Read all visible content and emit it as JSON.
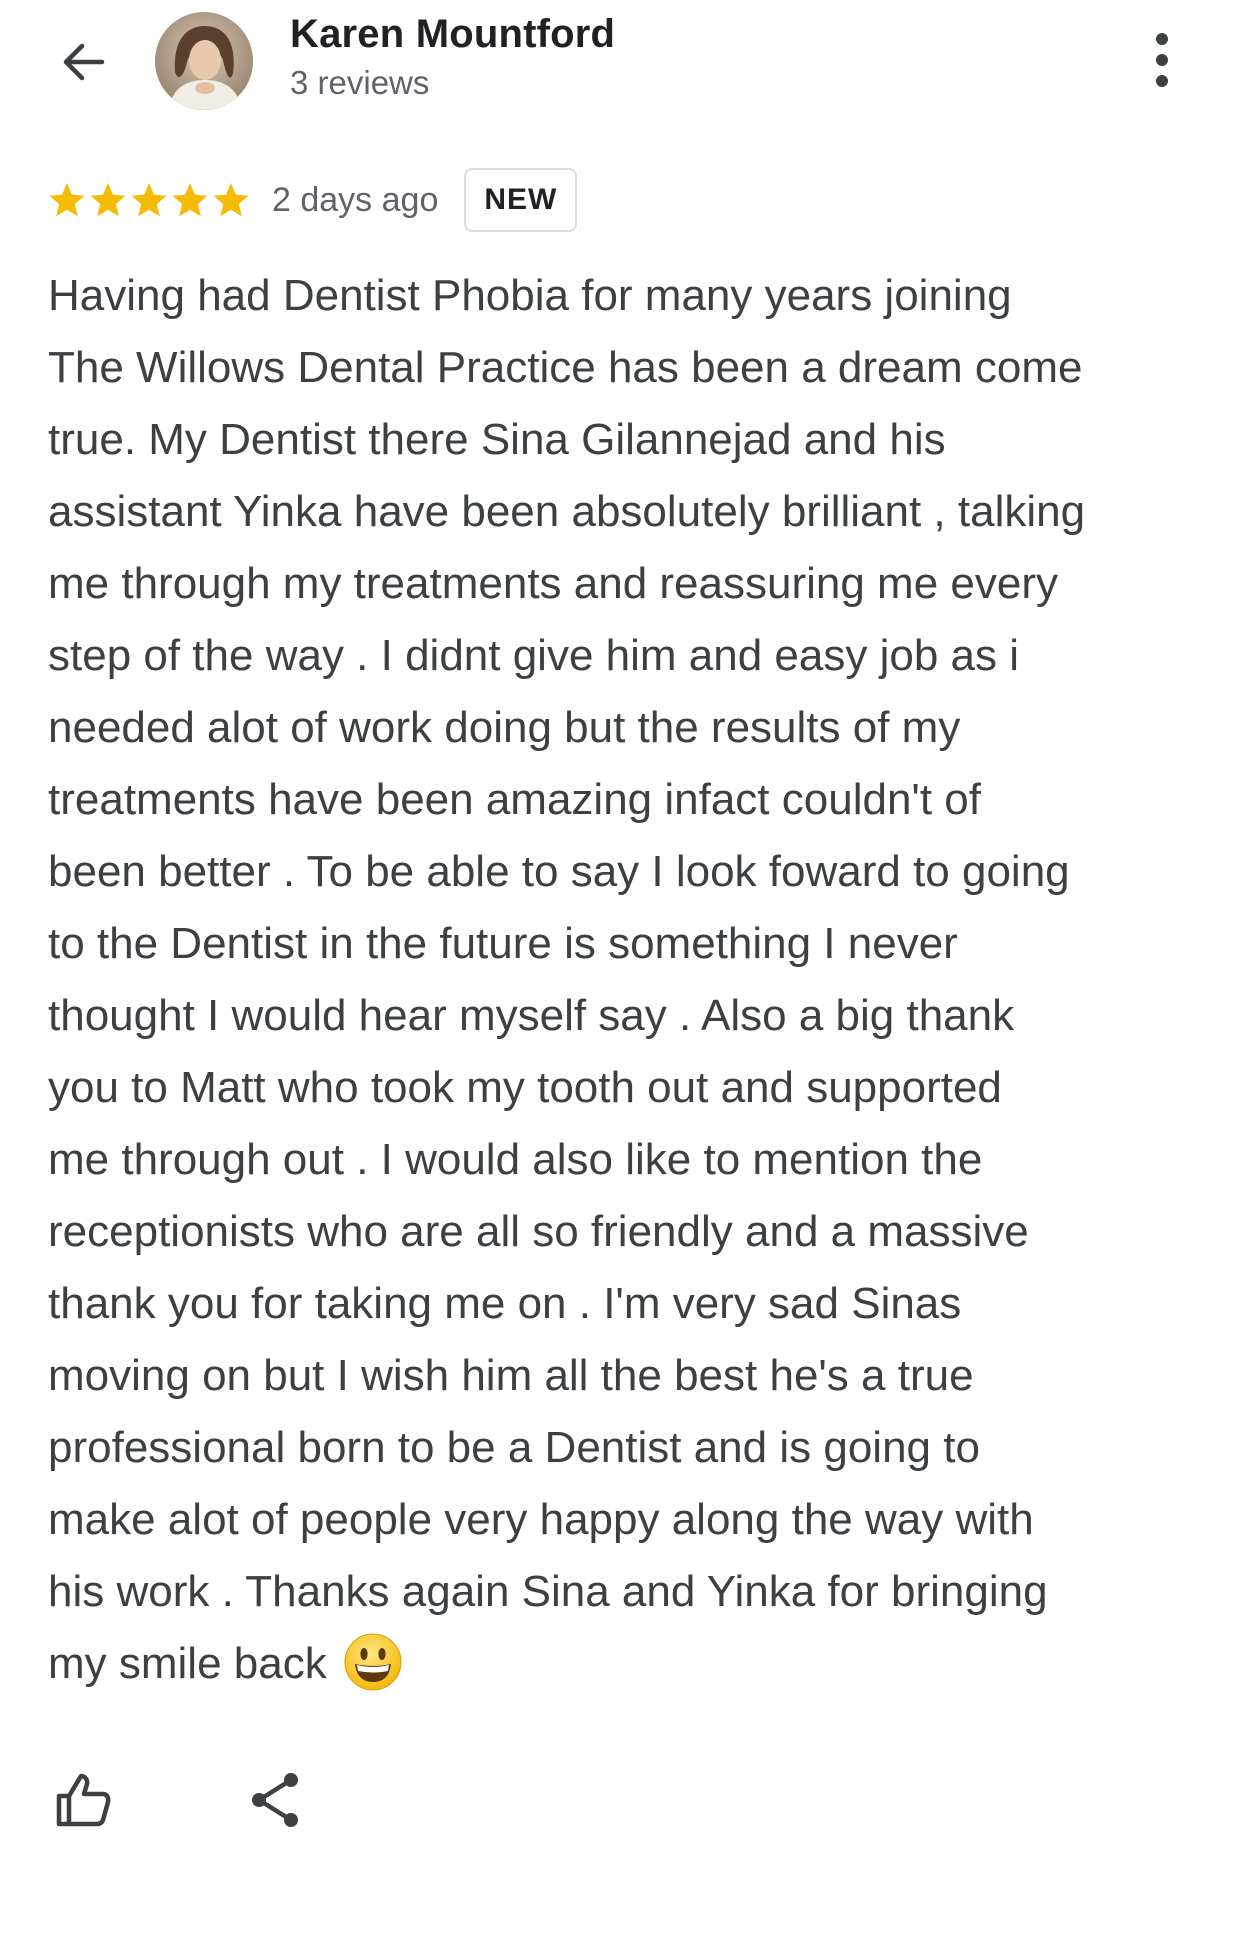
{
  "header": {
    "back_icon": "arrow-back-icon",
    "author_name": "Karen Mountford",
    "review_count": "3 reviews",
    "more_icon": "more-vert-icon"
  },
  "review": {
    "rating": 5,
    "rating_max": 5,
    "star_color": "#f6bb06",
    "date": "2 days ago",
    "badge": "NEW",
    "lines": [
      "Having had Dentist Phobia for many years joining",
      "The Willows Dental Practice has been a dream come",
      "true. My Dentist there Sina Gilannejad and his",
      "assistant Yinka have been absolutely brilliant , talking",
      "me through my treatments and reassuring me every",
      "step of the way . I didnt give him and easy job as i",
      "needed alot of work doing but the results of my",
      "treatments have been amazing infact couldn't of",
      "been better . To be able to say I look foward to going",
      "to the Dentist in the future is something I never",
      "thought I would hear myself say . Also a big thank",
      "you to Matt who took my tooth out and supported",
      "me through out . I would also like to mention the",
      "receptionists who are all so friendly and a massive",
      "thank you for taking me on . I'm very sad Sinas",
      "moving on but I wish him all the best he's a true",
      "professional born to be a Dentist and is going to",
      "make alot of people very happy along the way with",
      "his work . Thanks again Sina and Yinka for bringing",
      "my smile back"
    ],
    "trailing_emoji": "grinning-face-emoji"
  },
  "actions": {
    "like_icon": "thumb-up-icon",
    "share_icon": "share-icon"
  }
}
